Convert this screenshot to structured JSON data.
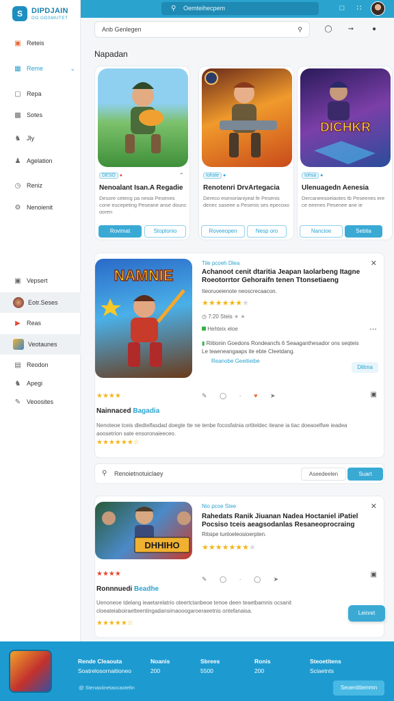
{
  "brand": {
    "name": "DIPDJAIN",
    "tagline": "DO GDSMUTET"
  },
  "topbar": {
    "search_placeholder": "Oemteihecpem"
  },
  "sidebar": {
    "items": [
      {
        "label": "Reteis"
      },
      {
        "label": "Reme"
      },
      {
        "label": "Repa"
      },
      {
        "label": "Sotes"
      },
      {
        "label": "Jly"
      },
      {
        "label": "Agelation"
      },
      {
        "label": "Reniz"
      },
      {
        "label": "Nenoienit"
      }
    ],
    "lower_items": [
      {
        "label": "Vepsert"
      },
      {
        "label": "Eotr.Seses"
      },
      {
        "label": "Reas"
      },
      {
        "label": "Veotaunes"
      },
      {
        "label": "Reodon"
      },
      {
        "label": "Apegi"
      },
      {
        "label": "Veoosites"
      }
    ]
  },
  "search": {
    "value": "Anb Genlegen"
  },
  "section_title": "Napadan",
  "cards": [
    {
      "tag": "DESO",
      "title": "Nenoalant Isan.A Regadie",
      "desc": "Desore ceteng pa nesia Pesenes cone eucepeting Peseane anse dounc ooren",
      "btn_primary": "Rovimat",
      "btn_secondary": "Stoptonio",
      "colors": [
        "#7cc16b",
        "#3f8f3a"
      ]
    },
    {
      "tag": "Iohste",
      "title": "Renotenri DrvArtegacia",
      "desc": "Dereco esenorianiyeal fe Pesenis denec saseee a Pesenis ses epecoxo",
      "btn_primary": "Roveeopen",
      "btn_secondary": "Nesp oro",
      "colors": [
        "#f09a2c",
        "#7a2a4a"
      ]
    },
    {
      "tag": "Iohsa",
      "title": "Ulenuagedn Aenesia",
      "desc": "Dercaneesoeiaotes tb Peseenes ere ce eeenes Pesenee ane ie",
      "btn_primary": "Nancioe",
      "btn_secondary": "Sebtia",
      "colors": [
        "#7b3fa8",
        "#2a4d9a"
      ],
      "art_text": "DICHKR"
    }
  ],
  "details": [
    {
      "genre": "Tile pcoeh Dlea",
      "title": "Achanoot cenit dtaritia Jeapan Iaolarbeng Itagne Roeotorrtor Gehoraifn tenen Ttonsetiaeng",
      "desc": "Iteoruoeienote neoscrecaacon.",
      "rating_full": 6,
      "rating_empty": 1,
      "meta": "7:20 Steis",
      "badge_text": "Hehteix eloe",
      "note": "Riitionin Goedons Rondeancfs 6 Seaaganthesador ons seqteis Le teaeneangaaps ite ebte Cleetdang.",
      "link": "Reanobe Geeitieibe",
      "action": "Dlitma",
      "sub_stars": 4,
      "sub_title_a": "Nainnaced",
      "sub_title_b": "Bagadia",
      "long_desc": "Nenoteoe tceis dledtelfasdad doegte tte ne tenbe focosfatnia ortiteldec iteane ia tiac doeaoelfwe ieadea aoosetrion sate ensoronaieeceo.",
      "long_stars_full": 6,
      "long_stars_half": 1,
      "art_text": "NAMNIE"
    },
    {
      "genre": "Nio pcoe Stee",
      "title": "Rahedats Ranik Jiuanan Nadea Hoctaniel iPatiel Pocsiso tceis aeagsodanlas Resaneoprocraing",
      "desc": "Ritsipe tunloeleosioerpten.",
      "rating_full": 7,
      "rating_empty": 1,
      "sub_stars": 4,
      "sub_title_a": "Ronnnuedi",
      "sub_title_b": "Beadhe",
      "long_desc": "Uenoneoe tdelang ieaetarelatrio oteertctanbeoe tenoe deen teaetbamnis ocsanit cloeateiaboiraetteentingadansimaooogaroeraeetnis ontefanaisa.",
      "long_stars_full": 5,
      "long_stars_half": 1,
      "art_text": "DHHIHO"
    }
  ],
  "review": {
    "placeholder": "Renoietnotuiclaey",
    "btn_secondary": "Aseedeelen",
    "btn_primary": "Suart"
  },
  "float_button": "Leinret",
  "footer": {
    "cols": [
      {
        "h": "Rende Cleaouta",
        "v": "Soatrelosornaitioneo"
      },
      {
        "h": "Noanis",
        "v": "200"
      },
      {
        "h": "Sbrees",
        "v": "5500"
      },
      {
        "h": "Ronis",
        "v": "200"
      },
      {
        "h": "Steoetitens",
        "v": "Sciaetnts"
      }
    ],
    "copyright": "@ Stenaoiinetaocaoteltn",
    "button": "Seoentitiemmn"
  }
}
